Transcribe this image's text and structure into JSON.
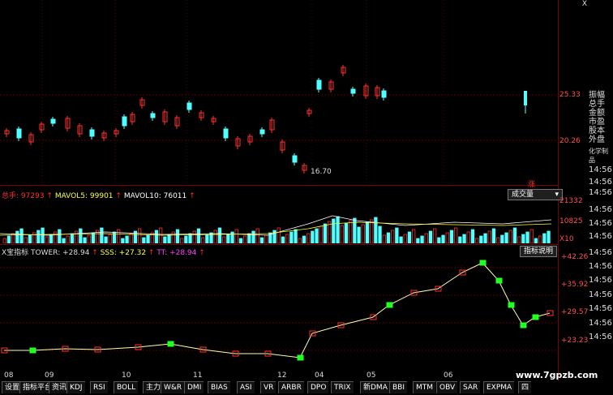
{
  "top_right": {
    "x_label": "X"
  },
  "main_chart": {
    "y_labels": [
      "25.33",
      "20.26"
    ],
    "price_annotation": "16.70",
    "x_ticks": [
      "08",
      "09",
      "10",
      "11",
      "12",
      "04",
      "05",
      "06"
    ]
  },
  "right_panel": {
    "labels": [
      "振幅",
      "总手",
      "金额",
      "市盈",
      "股本",
      "外盘",
      "化学制品"
    ],
    "times": [
      "14:56",
      "14:56",
      "14:56",
      "14:56",
      "14:56",
      "14:56",
      "14:56",
      "14:56",
      "14:56",
      "14:56",
      "14:56",
      "14:56",
      "14:56"
    ]
  },
  "volume_panel": {
    "info": {
      "zongshou_label": "总手:",
      "zongshou_value": "97293",
      "mavol5_label": "MAVOL5:",
      "mavol5_value": "99901",
      "mavol10_label": "MAVOL10:",
      "mavol10_value": "76011"
    },
    "dropdown_label": "成交量",
    "badge": "涨",
    "y_labels": [
      "21332",
      "10825",
      "X10"
    ]
  },
  "indicator_panel": {
    "info": {
      "title": "X宝指标",
      "tower_label": "TOWER:",
      "tower_value": "+28.94",
      "sss_label": "SSS:",
      "sss_value": "+27.32",
      "tt_label": "TT:",
      "tt_value": "+28.94"
    },
    "button_label": "指标说明",
    "y_labels": [
      "+42.26",
      "+35.92",
      "+29.57",
      "+23.23"
    ]
  },
  "bottom_tabs": [
    "设置",
    "指标平台",
    "资讯",
    "KDJ",
    "RSI",
    "BOLL",
    "主力",
    "W&R",
    "DMI",
    "BIAS",
    "ASI",
    "VR",
    "ARBR",
    "DPO",
    "TRIX",
    "新DMA",
    "BBI",
    "MTM",
    "OBV",
    "SAR",
    "EXPMA",
    "四"
  ],
  "watermark": "www.7gpzb.com",
  "colors": {
    "up": "#ff3030",
    "down": "#50ffff",
    "grid": "#7a0000",
    "green": "#22ff22"
  }
}
